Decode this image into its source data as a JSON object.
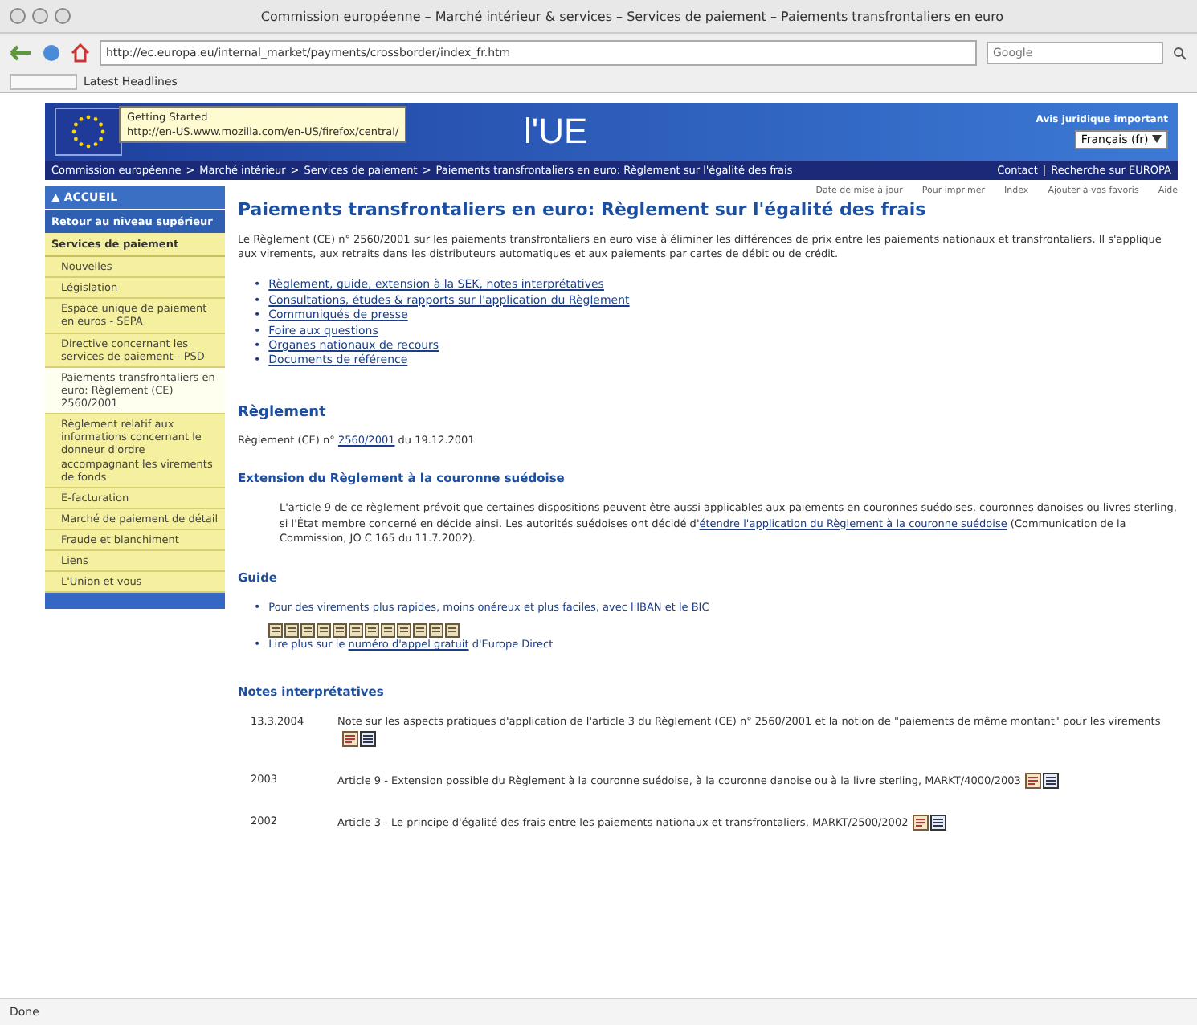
{
  "window": {
    "title": "Commission européenne – Marché intérieur & services – Services de paiement – Paiements transfrontaliers en euro"
  },
  "toolbar": {
    "url": "http://ec.europa.eu/internal_market/payments/crossborder/index_fr.htm",
    "search_placeholder": "Google"
  },
  "bookmarks": [
    "Latest Headlines"
  ],
  "tooltip": {
    "title": "Getting Started",
    "url": "http://en-US.www.mozilla.com/en-US/firefox/central/"
  },
  "banner": {
    "title": "l'UE",
    "legal": "Avis juridique important",
    "language": "Français (fr)"
  },
  "breadcrumb": [
    "Commission européenne",
    ">",
    "Marché intérieur",
    ">",
    "Services de paiement",
    ">",
    "Paiements transfrontaliers en euro: Règlement sur l'égalité des frais"
  ],
  "header_links": [
    "Contact",
    "|",
    "Recherche sur EUROPA"
  ],
  "bullet": "•",
  "page_tools": [
    "Date de mise à jour",
    "Pour imprimer",
    "Index",
    "Ajouter à vos favoris",
    "Aide"
  ],
  "sidebar": {
    "home": "▲ ACCUEIL",
    "back": "Retour au niveau supérieur",
    "section": "Services de paiement",
    "items": [
      {
        "label": "Nouvelles",
        "selected": false
      },
      {
        "label": "Législation",
        "selected": false
      },
      {
        "label": "Espace unique de paiement en euros - SEPA",
        "selected": false
      },
      {
        "label": "Directive concernant les services de paiement - PSD",
        "selected": false
      },
      {
        "label": "Paiements transfrontaliers en euro: Règlement (CE) 2560/2001",
        "selected": true
      },
      {
        "label": "Règlement relatif aux informations concernant le donneur d'ordre accompagnant les virements de fonds",
        "selected": false
      },
      {
        "label": "E-facturation",
        "selected": false
      },
      {
        "label": "Marché de paiement de détail",
        "selected": false
      },
      {
        "label": "Fraude et blanchiment",
        "selected": false
      },
      {
        "label": "Liens",
        "selected": false
      },
      {
        "label": "L'Union et vous",
        "selected": false
      }
    ]
  },
  "content": {
    "title": "Paiements transfrontaliers en euro: Règlement sur l'égalité des frais",
    "intro": "Le Règlement (CE) n° 2560/2001 sur les paiements transfrontaliers en euro vise à éliminer les différences de prix entre les paiements nationaux et transfrontaliers. Il s'applique aux virements, aux retraits dans les distributeurs automatiques et aux paiements par cartes de débit ou de crédit.",
    "links": [
      "Règlement, guide, extension à la SEK, notes interprétatives",
      "Consultations, études & rapports sur l'application du Règlement",
      "Communiqués de presse",
      "Foire aux questions",
      "Organes nationaux de recours",
      "Documents de référence"
    ],
    "reglement": {
      "heading": "Règlement",
      "text": {
        "before": "Règlement (CE) n° ",
        "link": "2560/2001",
        "after": " du 19.12.2001"
      }
    },
    "extension": {
      "heading": "Extension du Règlement à la couronne suédoise",
      "text": {
        "before": "L'article 9 de ce règlement prévoit que certaines dispositions peuvent être aussi applicables aux paiements en couronnes suédoises, couronnes danoises ou livres sterling, si l'État membre concerné en décide ainsi. Les autorités suédoises ont décidé d'",
        "link": "étendre l'application du Règlement à la couronne suédoise",
        "after": " (Communication de la Commission, JO C 165 du 11.7.2002)."
      }
    },
    "guide": {
      "heading": "Guide",
      "items": [
        {
          "kind": "languages",
          "text": {
            "before": "Pour des virements plus rapides, moins onéreux et plus faciles, avec l'IBAN et le BIC"
          }
        },
        {
          "kind": "plain",
          "text": {
            "before": "Lire plus sur le ",
            "link": "numéro d'appel gratuit",
            "after": " d'Europe Direct"
          }
        }
      ]
    },
    "notes": {
      "heading": "Notes interprétatives",
      "rows": [
        {
          "date": "13.3.2004",
          "text": "Note sur les aspects pratiques d'application de l'article 3 du Règlement (CE) n° 2560/2001 et la notion de \"paiements de même montant\" pour les virements"
        },
        {
          "date": "2003",
          "text": "Article 9 - Extension possible du Règlement à la couronne suédoise, à la couronne danoise ou à la livre sterling, MARKT/4000/2003"
        },
        {
          "date": "2002",
          "text": "Article 3 - Le principe d'égalité des frais entre les paiements nationaux et transfrontaliers, MARKT/2500/2002"
        }
      ]
    }
  },
  "status_bar": "Done"
}
